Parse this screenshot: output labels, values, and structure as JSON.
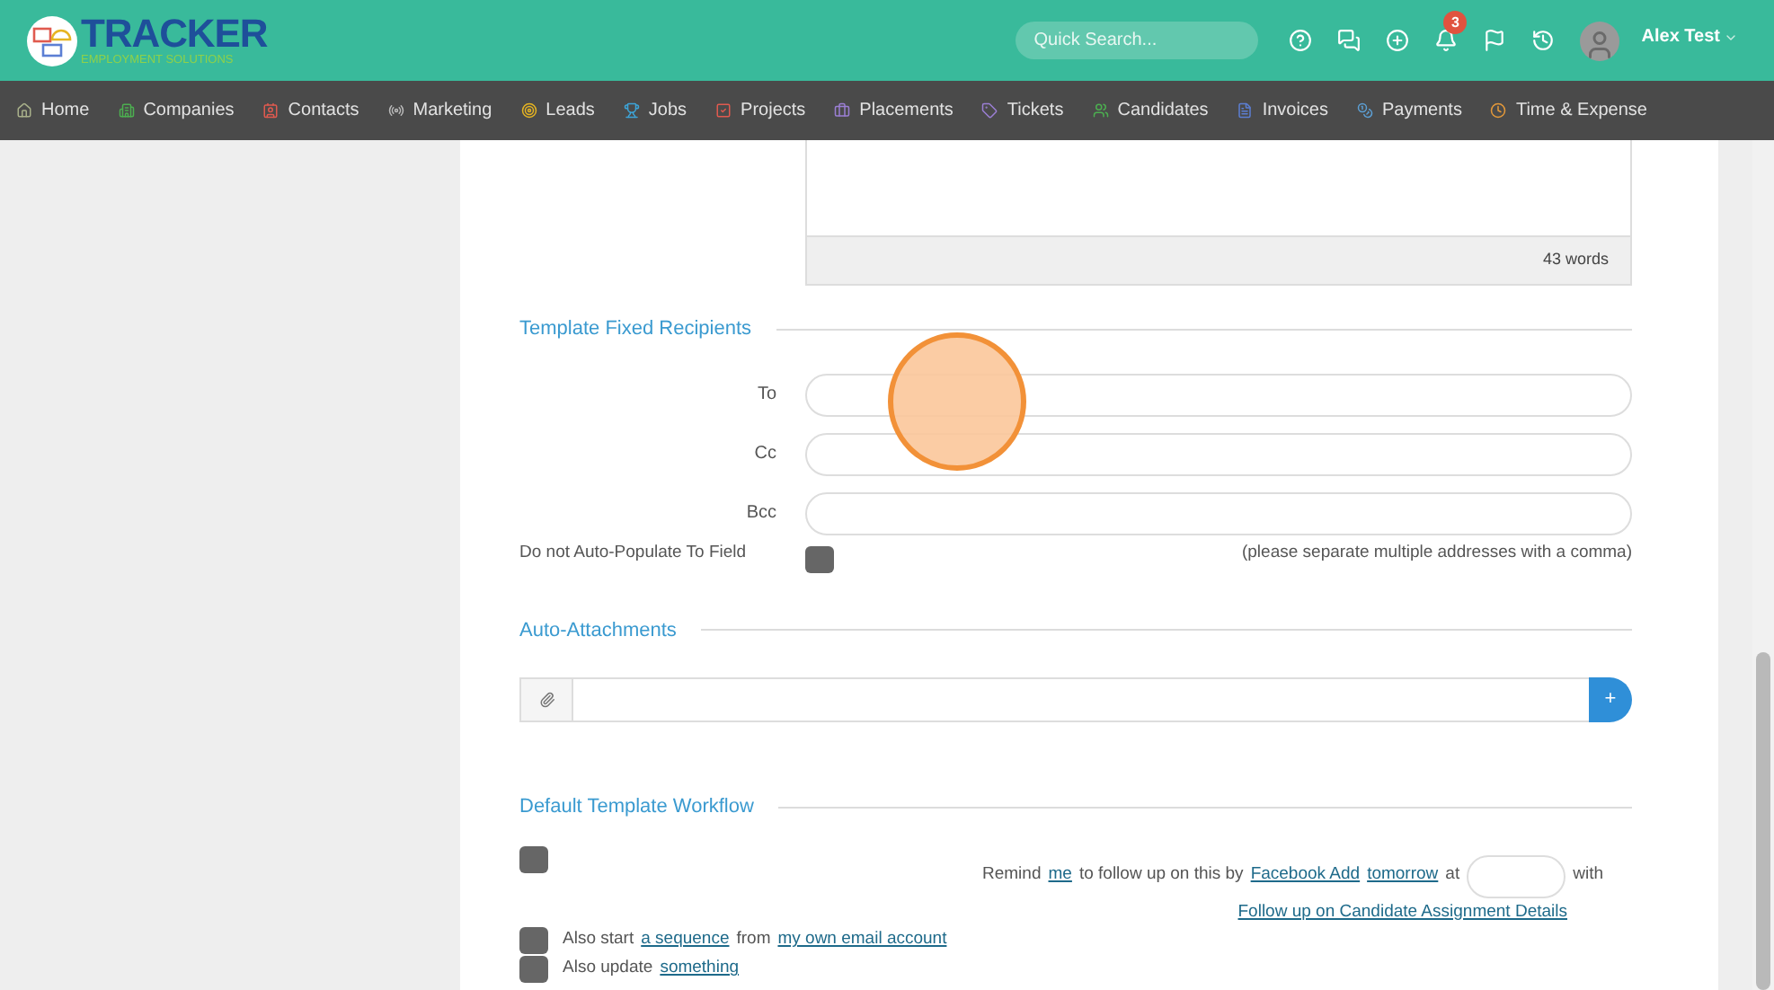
{
  "header": {
    "logo": {
      "title": "TRACKER",
      "subtitle": "EMPLOYMENT SOLUTIONS"
    },
    "search": {
      "placeholder": "Quick Search..."
    },
    "notifications": {
      "badge": "3"
    },
    "user": {
      "name": "Alex Test"
    }
  },
  "nav": [
    {
      "label": "Home",
      "color": "#a8b08a"
    },
    {
      "label": "Companies",
      "color": "#4caf50"
    },
    {
      "label": "Contacts",
      "color": "#e05a4f"
    },
    {
      "label": "Marketing",
      "color": "#bbbbbb"
    },
    {
      "label": "Leads",
      "color": "#e6b422"
    },
    {
      "label": "Jobs",
      "color": "#3da5d9"
    },
    {
      "label": "Projects",
      "color": "#e05a4f"
    },
    {
      "label": "Placements",
      "color": "#9b7fd4"
    },
    {
      "label": "Tickets",
      "color": "#9b7fd4"
    },
    {
      "label": "Candidates",
      "color": "#4caf50"
    },
    {
      "label": "Invoices",
      "color": "#5c7fd4"
    },
    {
      "label": "Payments",
      "color": "#5c9fd4"
    },
    {
      "label": "Time & Expense",
      "color": "#e69a3a"
    }
  ],
  "editor": {
    "word_count": "43 words"
  },
  "recipients": {
    "title": "Template Fixed Recipients",
    "fields": [
      {
        "label": "To"
      },
      {
        "label": "Cc"
      },
      {
        "label": "Bcc"
      }
    ],
    "auto_populate": {
      "label": "Do not Auto-Populate To Field",
      "checked": false
    },
    "hint": "(please separate multiple addresses with a comma)"
  },
  "attachments": {
    "title": "Auto-Attachments",
    "add_button": "+"
  },
  "workflow": {
    "title": "Default Template Workflow",
    "remind": {
      "checked": false,
      "parts": [
        {
          "kind": "text",
          "text": "Remind"
        },
        {
          "kind": "link",
          "text": "me"
        },
        {
          "kind": "text",
          "text": "to follow up on this by"
        },
        {
          "kind": "link",
          "text": "Facebook Add"
        },
        {
          "kind": "link",
          "text": "tomorrow"
        },
        {
          "kind": "text",
          "text": "at"
        },
        {
          "kind": "input"
        },
        {
          "kind": "text",
          "text": "with"
        }
      ],
      "follow_link": "Follow up on Candidate Assignment Details"
    },
    "rows": [
      {
        "checked": false,
        "parts": [
          {
            "kind": "text",
            "text": "Also start"
          },
          {
            "kind": "link",
            "text": "a sequence"
          },
          {
            "kind": "text",
            "text": "from"
          },
          {
            "kind": "link",
            "text": "my own email account"
          }
        ]
      },
      {
        "checked": false,
        "parts": [
          {
            "kind": "text",
            "text": "Also update"
          },
          {
            "kind": "link",
            "text": "something"
          }
        ]
      }
    ]
  }
}
